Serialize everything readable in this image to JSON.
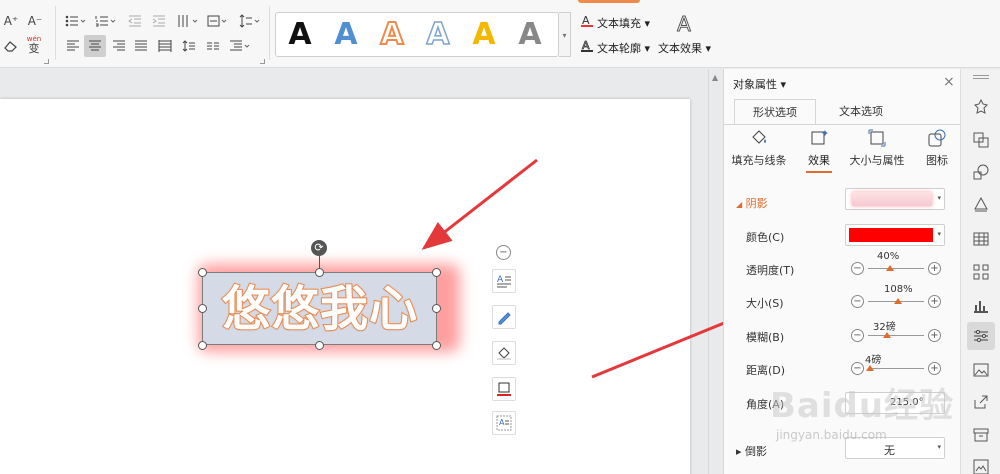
{
  "ribbon": {
    "font_ops": [
      "A⁺",
      "A⁻"
    ],
    "pinyin_label": "wén",
    "pinyin_char": "变",
    "text_fill": "文本填充",
    "text_outline": "文本轮廓",
    "text_effect": "文本效果",
    "text_effect_glyph": "A",
    "gallery_letter": "A",
    "gallery_colors": [
      "#111111",
      "#4f8fd2",
      "#ee8a4c",
      "#9ab8d9",
      "#f5b800",
      "#888888"
    ]
  },
  "canvas": {
    "wordart_text": "悠悠我心",
    "rotate_glyph": "⟳",
    "minus_glyph": "−"
  },
  "panel": {
    "title": "对象属性",
    "close_glyph": "×",
    "tabs": [
      "形状选项",
      "文本选项"
    ],
    "subtabs": [
      "填充与线条",
      "效果",
      "大小与属性",
      "图标"
    ],
    "section": "阴影",
    "section_glyph": "◢",
    "rows": {
      "color": "颜色(C)",
      "transparency": "透明度(T)",
      "size": "大小(S)",
      "blur": "模糊(B)",
      "distance": "距离(D)",
      "angle": "角度(A)"
    },
    "values": {
      "transparency": "40%",
      "size": "108%",
      "blur": "32磅",
      "distance": "4磅",
      "angle": "215.0°"
    },
    "slider_levels": {
      "transparency": 0.4,
      "size": 0.54,
      "blur": 0.34,
      "distance": 0.04
    },
    "shadow_color": "#ff0000",
    "reflection": "倒影",
    "reflection_value": "无"
  },
  "watermark": {
    "brand": "Baidu经验",
    "url": "jingyan.baidu.com"
  },
  "colors": {
    "accent": "#e06b2c",
    "arrow": "#e5383b"
  }
}
